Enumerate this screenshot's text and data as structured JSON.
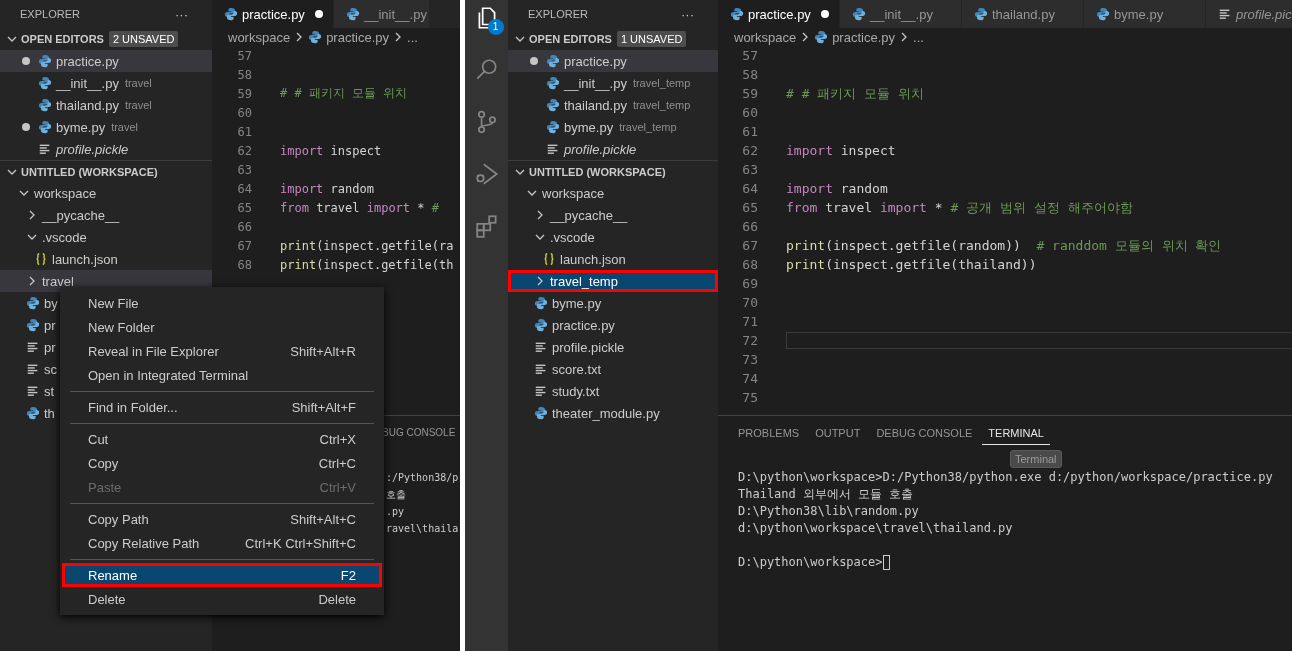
{
  "left": {
    "sidebar": {
      "title": "EXPLORER",
      "more": "···",
      "open_editors": {
        "title": "OPEN EDITORS",
        "badge": "2 UNSAVED",
        "expanded": true,
        "items": [
          {
            "name": "practice.py",
            "kind": "python",
            "dirty": true,
            "selected": true,
            "preview": false
          },
          {
            "name": "__init__.py",
            "folder": "travel",
            "kind": "python",
            "dirty": false,
            "selected": false,
            "preview": false
          },
          {
            "name": "thailand.py",
            "folder": "travel",
            "kind": "python",
            "dirty": false,
            "selected": false,
            "preview": false
          },
          {
            "name": "byme.py",
            "folder": "travel",
            "kind": "python",
            "dirty": true,
            "selected": false,
            "preview": false
          },
          {
            "name": "profile.pickle",
            "kind": "text",
            "dirty": false,
            "selected": false,
            "preview": true
          }
        ]
      },
      "workspace": {
        "title": "UNTITLED (WORKSPACE)",
        "expanded": true,
        "focused": false,
        "tree": [
          {
            "name": "workspace",
            "kind": "folder",
            "expanded": true,
            "selected": false,
            "highlighted": false,
            "children": [
              {
                "name": "__pycache__",
                "kind": "folder",
                "expanded": false,
                "selected": false,
                "highlighted": false
              },
              {
                "name": ".vscode",
                "kind": "folder",
                "expanded": true,
                "selected": false,
                "highlighted": false,
                "children": [
                  {
                    "name": "launch.json",
                    "kind": "json",
                    "selected": false,
                    "highlighted": false
                  }
                ]
              },
              {
                "name": "travel",
                "kind": "folder",
                "expanded": false,
                "selected": true,
                "highlighted": false
              },
              {
                "name": "by",
                "kind": "python",
                "selected": false,
                "highlighted": false
              },
              {
                "name": "pr",
                "kind": "python",
                "selected": false,
                "highlighted": false
              },
              {
                "name": "pr",
                "kind": "text",
                "selected": false,
                "highlighted": false
              },
              {
                "name": "sc",
                "kind": "text",
                "selected": false,
                "highlighted": false
              },
              {
                "name": "st",
                "kind": "text",
                "selected": false,
                "highlighted": false
              },
              {
                "name": "th",
                "kind": "python",
                "selected": false,
                "highlighted": false
              }
            ]
          }
        ]
      }
    },
    "editor": {
      "tabs": [
        {
          "label": "practice.py",
          "kind": "python",
          "dirty": true,
          "selected": true,
          "preview": false
        },
        {
          "label": "__init__.py",
          "kind": "python",
          "dirty": false,
          "selected": false,
          "preview": false
        }
      ],
      "breadcrumb": [
        {
          "text": "workspace"
        },
        {
          "text": "practice.py",
          "kind": "python"
        },
        {
          "text": "..."
        }
      ],
      "lines": [
        {
          "number": "57"
        },
        {
          "number": "58"
        },
        {
          "number": "59",
          "tokens": [
            {
              "kind": "comment",
              "text": "# # 패키지 모듈 위치"
            }
          ]
        },
        {
          "number": "60"
        },
        {
          "number": "61"
        },
        {
          "number": "62",
          "tokens": [
            {
              "kind": "keyword",
              "text": "import"
            },
            {
              "kind": "text",
              "text": " inspect"
            }
          ]
        },
        {
          "number": "63"
        },
        {
          "number": "64",
          "tokens": [
            {
              "kind": "keyword",
              "text": "import"
            },
            {
              "kind": "text",
              "text": " random"
            }
          ]
        },
        {
          "number": "65",
          "tokens": [
            {
              "kind": "keyword",
              "text": "from"
            },
            {
              "kind": "text",
              "text": " travel "
            },
            {
              "kind": "keyword",
              "text": "import"
            },
            {
              "kind": "text",
              "text": " * "
            },
            {
              "kind": "comment",
              "text": "#"
            }
          ]
        },
        {
          "number": "66"
        },
        {
          "number": "67",
          "tokens": [
            {
              "kind": "function",
              "text": "print"
            },
            {
              "kind": "text",
              "text": "(inspect.getfile(ra"
            }
          ]
        },
        {
          "number": "68",
          "tokens": [
            {
              "kind": "function",
              "text": "print"
            },
            {
              "kind": "text",
              "text": "(inspect.getfile(th"
            }
          ]
        }
      ]
    },
    "panel": {
      "tabs": [
        {
          "label": "BUG CONSOLE",
          "selected": false
        }
      ],
      "terminal": [
        ":/Python38/p",
        "호출",
        ".py",
        "ravel\\thaila"
      ]
    },
    "context_menu": {
      "groups": [
        [
          {
            "label": "New File",
            "disabled": false,
            "selected": false,
            "highlighted": false
          },
          {
            "label": "New Folder",
            "disabled": false,
            "selected": false,
            "highlighted": false
          },
          {
            "label": "Reveal in File Explorer",
            "shortcut": "Shift+Alt+R",
            "disabled": false,
            "selected": false,
            "highlighted": false
          },
          {
            "label": "Open in Integrated Terminal",
            "disabled": false,
            "selected": false,
            "highlighted": false
          }
        ],
        [
          {
            "label": "Find in Folder...",
            "shortcut": "Shift+Alt+F",
            "disabled": false,
            "selected": false,
            "highlighted": false
          }
        ],
        [
          {
            "label": "Cut",
            "shortcut": "Ctrl+X",
            "disabled": false,
            "selected": false,
            "highlighted": false
          },
          {
            "label": "Copy",
            "shortcut": "Ctrl+C",
            "disabled": false,
            "selected": false,
            "highlighted": false
          },
          {
            "label": "Paste",
            "shortcut": "Ctrl+V",
            "disabled": true,
            "selected": false,
            "highlighted": false
          }
        ],
        [
          {
            "label": "Copy Path",
            "shortcut": "Shift+Alt+C",
            "disabled": false,
            "selected": false,
            "highlighted": false
          },
          {
            "label": "Copy Relative Path",
            "shortcut": "Ctrl+K Ctrl+Shift+C",
            "disabled": false,
            "selected": false,
            "highlighted": false
          }
        ],
        [
          {
            "label": "Rename",
            "shortcut": "F2",
            "disabled": false,
            "selected": true,
            "highlighted": true
          },
          {
            "label": "Delete",
            "shortcut": "Delete",
            "disabled": false,
            "selected": false,
            "highlighted": false
          }
        ]
      ]
    }
  },
  "right": {
    "activity_bar": [
      {
        "kind": "files",
        "badge": "1",
        "selected": true
      },
      {
        "kind": "search",
        "selected": false
      },
      {
        "kind": "source_control",
        "selected": false
      },
      {
        "kind": "run_debug",
        "selected": false
      },
      {
        "kind": "extensions",
        "selected": false
      }
    ],
    "sidebar": {
      "title": "EXPLORER",
      "more": "···",
      "open_editors": {
        "title": "OPEN EDITORS",
        "badge": "1 UNSAVED",
        "expanded": true,
        "items": [
          {
            "name": "practice.py",
            "kind": "python",
            "dirty": true,
            "selected": true,
            "preview": false
          },
          {
            "name": "__init__.py",
            "folder": "travel_temp",
            "kind": "python",
            "dirty": false,
            "selected": false,
            "preview": false
          },
          {
            "name": "thailand.py",
            "folder": "travel_temp",
            "kind": "python",
            "dirty": false,
            "selected": false,
            "preview": false
          },
          {
            "name": "byme.py",
            "folder": "travel_temp",
            "kind": "python",
            "dirty": false,
            "selected": false,
            "preview": false
          },
          {
            "name": "profile.pickle",
            "kind": "text",
            "dirty": false,
            "selected": false,
            "preview": true
          }
        ]
      },
      "workspace": {
        "title": "UNTITLED (WORKSPACE)",
        "expanded": true,
        "focused": true,
        "tree": [
          {
            "name": "workspace",
            "kind": "folder",
            "expanded": true,
            "selected": false,
            "highlighted": false,
            "children": [
              {
                "name": "__pycache__",
                "kind": "folder",
                "expanded": false,
                "selected": false,
                "highlighted": false
              },
              {
                "name": ".vscode",
                "kind": "folder",
                "expanded": true,
                "selected": false,
                "highlighted": false,
                "children": [
                  {
                    "name": "launch.json",
                    "kind": "json",
                    "selected": false,
                    "highlighted": false
                  }
                ]
              },
              {
                "name": "travel_temp",
                "kind": "folder",
                "expanded": false,
                "selected": true,
                "highlighted": true
              },
              {
                "name": "byme.py",
                "kind": "python",
                "selected": false,
                "highlighted": false
              },
              {
                "name": "practice.py",
                "kind": "python",
                "selected": false,
                "highlighted": false
              },
              {
                "name": "profile.pickle",
                "kind": "text",
                "selected": false,
                "highlighted": false
              },
              {
                "name": "score.txt",
                "kind": "text",
                "selected": false,
                "highlighted": false
              },
              {
                "name": "study.txt",
                "kind": "text",
                "selected": false,
                "highlighted": false
              },
              {
                "name": "theater_module.py",
                "kind": "python",
                "selected": false,
                "highlighted": false
              }
            ]
          }
        ]
      }
    },
    "editor": {
      "tabs": [
        {
          "label": "practice.py",
          "kind": "python",
          "dirty": true,
          "selected": true,
          "preview": false
        },
        {
          "label": "__init__.py",
          "kind": "python",
          "dirty": false,
          "selected": false,
          "preview": false
        },
        {
          "label": "thailand.py",
          "kind": "python",
          "dirty": false,
          "selected": false,
          "preview": false
        },
        {
          "label": "byme.py",
          "kind": "python",
          "dirty": false,
          "selected": false,
          "preview": false
        },
        {
          "label": "profile.pic",
          "kind": "text",
          "dirty": false,
          "selected": false,
          "preview": true
        }
      ],
      "breadcrumb": [
        {
          "text": "workspace"
        },
        {
          "text": "practice.py",
          "kind": "python"
        },
        {
          "text": "..."
        }
      ],
      "lines": [
        {
          "number": "57",
          "current": false
        },
        {
          "number": "58",
          "current": false
        },
        {
          "number": "59",
          "current": false,
          "tokens": [
            {
              "kind": "comment",
              "text": "# # 패키지 모듈 위치"
            }
          ]
        },
        {
          "number": "60",
          "current": false
        },
        {
          "number": "61",
          "current": false
        },
        {
          "number": "62",
          "current": false,
          "tokens": [
            {
              "kind": "keyword",
              "text": "import"
            },
            {
              "kind": "text",
              "text": " inspect"
            }
          ]
        },
        {
          "number": "63",
          "current": false
        },
        {
          "number": "64",
          "current": false,
          "tokens": [
            {
              "kind": "keyword",
              "text": "import"
            },
            {
              "kind": "text",
              "text": " random"
            }
          ]
        },
        {
          "number": "65",
          "current": false,
          "tokens": [
            {
              "kind": "keyword",
              "text": "from"
            },
            {
              "kind": "text",
              "text": " travel "
            },
            {
              "kind": "keyword",
              "text": "import"
            },
            {
              "kind": "text",
              "text": " * "
            },
            {
              "kind": "comment",
              "text": "# 공개 범위 설정 해주어야함"
            }
          ]
        },
        {
          "number": "66",
          "current": false
        },
        {
          "number": "67",
          "current": false,
          "tokens": [
            {
              "kind": "function",
              "text": "print"
            },
            {
              "kind": "text",
              "text": "(inspect.getfile(random))  "
            },
            {
              "kind": "comment",
              "text": "# randdom 모듈의 위치 확인"
            }
          ]
        },
        {
          "number": "68",
          "current": false,
          "tokens": [
            {
              "kind": "function",
              "text": "print"
            },
            {
              "kind": "text",
              "text": "(inspect.getfile(thailand))"
            }
          ]
        },
        {
          "number": "69",
          "current": false
        },
        {
          "number": "70",
          "current": false
        },
        {
          "number": "71",
          "current": false
        },
        {
          "number": "72",
          "current": true
        },
        {
          "number": "73",
          "current": false
        },
        {
          "number": "74",
          "current": false
        },
        {
          "number": "75",
          "current": false
        }
      ]
    },
    "panel": {
      "tabs": [
        {
          "label": "PROBLEMS",
          "selected": false
        },
        {
          "label": "OUTPUT",
          "selected": false
        },
        {
          "label": "DEBUG CONSOLE",
          "selected": false
        },
        {
          "label": "TERMINAL",
          "selected": true
        }
      ],
      "tooltip": "Terminal",
      "terminal": [
        "D:\\python\\workspace>D:/Python38/python.exe d:/python/workspace/practice.py",
        "Thailand 외부에서 모듈 호출",
        "D:\\Python38\\lib\\random.py",
        "d:\\python\\workspace\\travel\\thailand.py"
      ],
      "prompt": "D:\\python\\workspace>"
    }
  }
}
